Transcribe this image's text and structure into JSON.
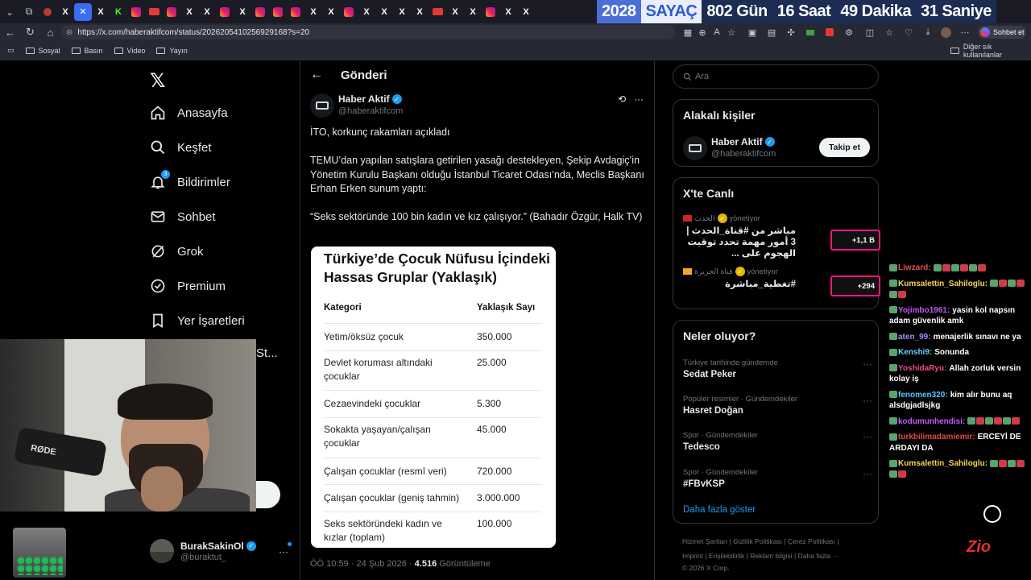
{
  "browser": {
    "url": "https://x.com/haberaktifcom/status/2026205410256929168?s=20",
    "chat_button": "Sohbet et",
    "bookmarks": [
      "Sosyal",
      "Basın",
      "Video",
      "Yayın"
    ],
    "other_bookmarks": "Diğer sık kullanılanlar"
  },
  "counter": {
    "year": "2028",
    "label": "SAYAÇ",
    "days": "802 Gün",
    "hours": "16 Saat",
    "minutes": "49 Dakika",
    "seconds": "31 Saniye"
  },
  "nav": {
    "items": [
      {
        "label": "Anasayfa",
        "icon": "home-icon"
      },
      {
        "label": "Keşfet",
        "icon": "search-icon"
      },
      {
        "label": "Bildirimler",
        "icon": "bell-icon",
        "badge": "3"
      },
      {
        "label": "Sohbet",
        "icon": "mail-icon"
      },
      {
        "label": "Grok",
        "icon": "grok-icon"
      },
      {
        "label": "Premium",
        "icon": "premium-icon"
      },
      {
        "label": "Yer İşaretleri",
        "icon": "bookmark-icon"
      }
    ],
    "overflow": "St..."
  },
  "account": {
    "name": "BurakSakinOl",
    "handle": "@buraktut_"
  },
  "post": {
    "header": "Gönderi",
    "author_name": "Haber Aktif",
    "author_handle": "@haberaktifcom",
    "p1": "İTO, korkunç rakamları açıkladı",
    "p2": "TEMU’dan yapılan satışlara getirilen yasağı destekleyen, Şekip Avdagiç’in Yönetim Kurulu Başkanı olduğu İstanbul Ticaret Odası’nda, Meclis Başkanı Erhan Erken sunum yaptı:",
    "p3": "“Seks sektöründe 100 bin kadın ve kız çalışıyor.” (Bahadır Özgür, Halk TV)",
    "time": "ÖÖ 10:59 · 24 Şub 2026 ·",
    "views": "4.516",
    "views_label": "Görüntüleme"
  },
  "table": {
    "title": "Türkiye’de Çocuk Nüfusu İçindeki Hassas Gruplar (Yaklaşık)",
    "col1": "Kategori",
    "col2": "Yaklaşık Sayı",
    "rows": [
      {
        "k": "Yetim/öksüz çocuk",
        "v": "350.000"
      },
      {
        "k": "Devlet koruması altındaki çocuklar",
        "v": "25.000"
      },
      {
        "k": "Cezaevindeki çocuklar",
        "v": "5.300"
      },
      {
        "k": "Sokakta yaşayan/çalışan çocuklar",
        "v": "45.000"
      },
      {
        "k": "Çalışan çocuklar (resmî veri)",
        "v": "720.000"
      },
      {
        "k": "Çalışan çocuklar (geniş tahmin)",
        "v": "3.000.000"
      },
      {
        "k": "Seks sektöründeki kadın ve kızlar (toplam)",
        "v": "100.000"
      }
    ]
  },
  "sidebar": {
    "search_placeholder": "Ara",
    "related_title": "Alakalı kişiler",
    "related_name": "Haber Aktif",
    "related_handle": "@haberaktifcom",
    "follow_label": "Takip et",
    "live_title": "X'te Canlı",
    "live": [
      {
        "source": "الحدث",
        "role": "yönetiyor",
        "title": "مباشر من #قناة_الحدث | 3 أمور مهمة تحدد توقيت الهجوم على ...",
        "count": "+1,1 B"
      },
      {
        "source": "قناة الجزيرة",
        "role": "yönetiyor",
        "title": "#تغطية_مباشرة",
        "count": "+294"
      }
    ],
    "trends_title": "Neler oluyor?",
    "trends": [
      {
        "cat": "Türkiye tarihinde gündemde",
        "name": "Sedat Peker"
      },
      {
        "cat": "Popüler resimler · Gündemdekiler",
        "name": "Hasret Doğan"
      },
      {
        "cat": "Spor · Gündemdekiler",
        "name": "Tedesco"
      },
      {
        "cat": "Spor · Gündemdekiler",
        "name": "#FBvKSP"
      }
    ],
    "show_more": "Daha fazla göster",
    "footer1": "Hizmet Şartları  |  Gizlilik Politikası  |  Çerez Politikası  |",
    "footer2": "Imprint  |  Erişilebilirlik  |  Reklam bilgisi  |  Daha fazla ···",
    "footer3": "© 2026 X Corp."
  },
  "chat": [
    {
      "user": "Liwzard:",
      "color": "#e05050",
      "msg": ""
    },
    {
      "user": "Kumsalettin_Sahiloglu:",
      "color": "#f3d35b",
      "msg": ""
    },
    {
      "user": "Yojimbo1961:",
      "color": "#c05bf3",
      "msg": "yasin kol napsın adam güvenlik amk"
    },
    {
      "user": "aten_99:",
      "color": "#9b8cff",
      "msg": "menajerlik sınavı ne ya"
    },
    {
      "user": "Kenshi9:",
      "color": "#6bd0ff",
      "msg": "Sonunda"
    },
    {
      "user": "YoshidaRyu:",
      "color": "#e84b85",
      "msg": "Allah zorluk versin kolay iş"
    },
    {
      "user": "fenomen320:",
      "color": "#58c7ff",
      "msg": "kim alır bunu aq alsdgjadlsjkg"
    },
    {
      "user": "kodumunhendisi:",
      "color": "#c65bff",
      "msg": ""
    },
    {
      "user": "turkbilimadamiemir:",
      "color": "#e04848",
      "msg": "ERCEYİ DE ARDAYI DA"
    },
    {
      "user": "Kumsalettin_Sahiloglu:",
      "color": "#f3d35b",
      "msg": ""
    }
  ],
  "webcam": {
    "mic_brand": "RØDE"
  },
  "overlay_logo": "Zio"
}
